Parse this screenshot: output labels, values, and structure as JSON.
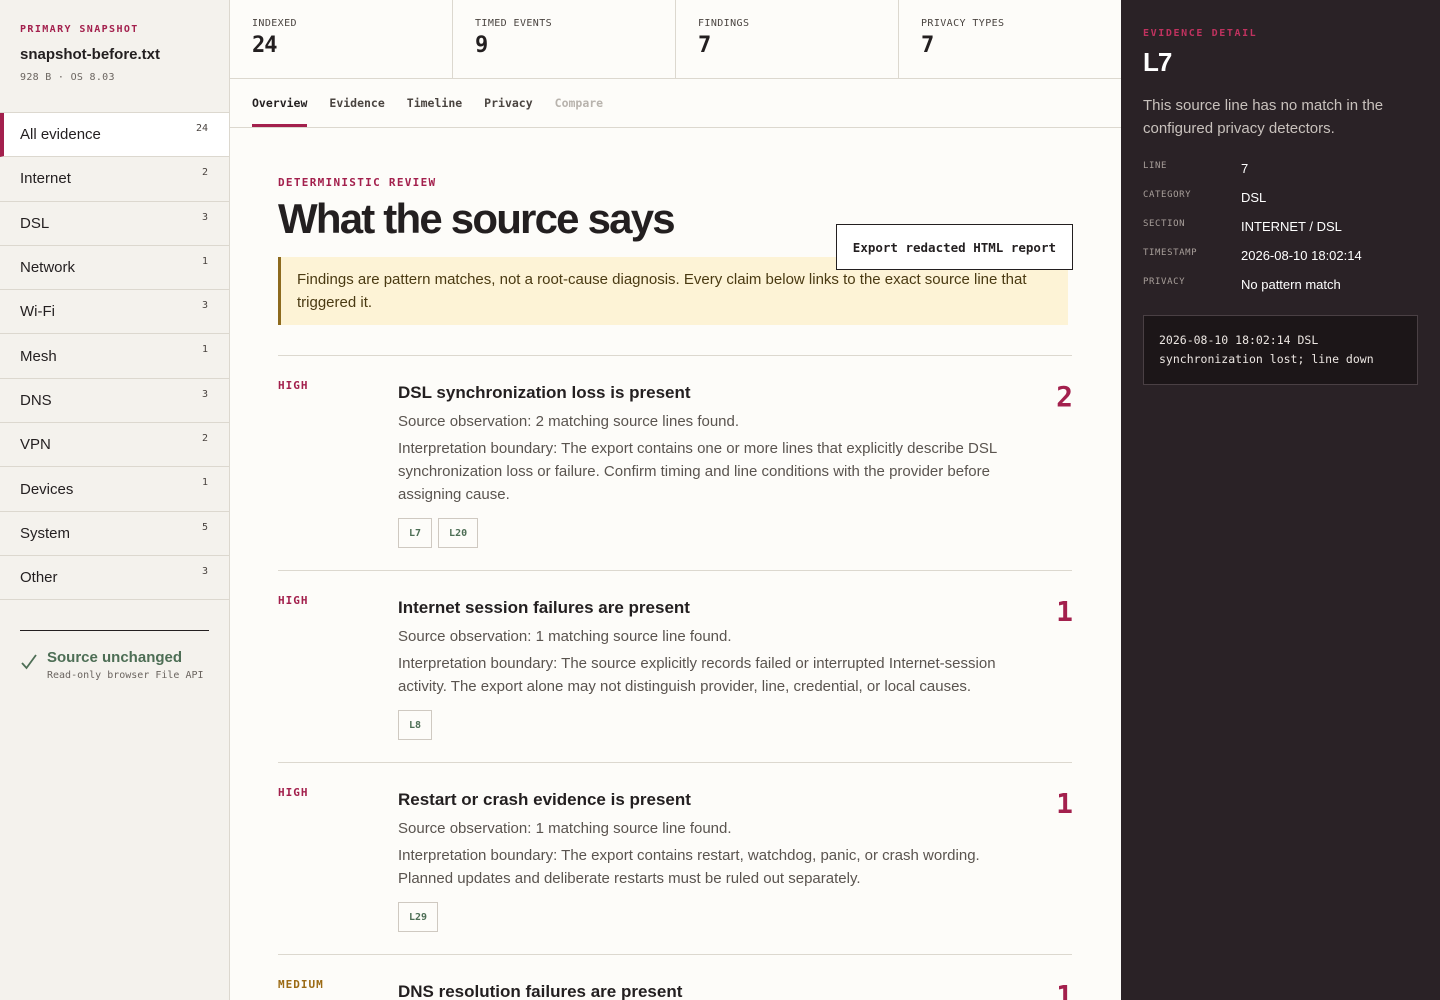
{
  "sidebar": {
    "kicker": "PRIMARY SNAPSHOT",
    "file_name": "snapshot-before.txt",
    "file_meta": "928 B · OS 8.03",
    "items": [
      {
        "label": "All evidence",
        "count": "24"
      },
      {
        "label": "Internet",
        "count": "2"
      },
      {
        "label": "DSL",
        "count": "3"
      },
      {
        "label": "Network",
        "count": "1"
      },
      {
        "label": "Wi-Fi",
        "count": "3"
      },
      {
        "label": "Mesh",
        "count": "1"
      },
      {
        "label": "DNS",
        "count": "3"
      },
      {
        "label": "VPN",
        "count": "2"
      },
      {
        "label": "Devices",
        "count": "1"
      },
      {
        "label": "System",
        "count": "5"
      },
      {
        "label": "Other",
        "count": "3"
      }
    ],
    "source_status": "Source unchanged",
    "source_sub": "Read-only browser File API"
  },
  "stats": [
    {
      "label": "INDEXED",
      "value": "24"
    },
    {
      "label": "TIMED EVENTS",
      "value": "9"
    },
    {
      "label": "FINDINGS",
      "value": "7"
    },
    {
      "label": "PRIVACY TYPES",
      "value": "7"
    }
  ],
  "tabs": [
    {
      "label": "Overview",
      "state": "active"
    },
    {
      "label": "Evidence",
      "state": "normal"
    },
    {
      "label": "Timeline",
      "state": "normal"
    },
    {
      "label": "Privacy",
      "state": "normal"
    },
    {
      "label": "Compare",
      "state": "disabled"
    }
  ],
  "main": {
    "kicker": "DETERMINISTIC REVIEW",
    "title": "What the source says",
    "export_label": "Export redacted HTML report",
    "notice": "Findings are pattern matches, not a root-cause diagnosis. Every claim below links to the exact source line that triggered it."
  },
  "findings": [
    {
      "severity": "HIGH",
      "title": "DSL synchronization loss is present",
      "observation": "Source observation: 2 matching source lines found.",
      "interpretation": "Interpretation boundary: The export contains one or more lines that explicitly describe DSL synchronization loss or failure. Confirm timing and line conditions with the provider before assigning cause.",
      "lines": [
        "L7",
        "L20"
      ],
      "count": "2"
    },
    {
      "severity": "HIGH",
      "title": "Internet session failures are present",
      "observation": "Source observation: 1 matching source line found.",
      "interpretation": "Interpretation boundary: The source explicitly records failed or interrupted Internet-session activity. The export alone may not distinguish provider, line, credential, or local causes.",
      "lines": [
        "L8"
      ],
      "count": "1"
    },
    {
      "severity": "HIGH",
      "title": "Restart or crash evidence is present",
      "observation": "Source observation: 1 matching source line found.",
      "interpretation": "Interpretation boundary: The export contains restart, watchdog, panic, or crash wording. Planned updates and deliberate restarts must be ruled out separately.",
      "lines": [
        "L29"
      ],
      "count": "1"
    },
    {
      "severity": "MEDIUM",
      "title": "DNS resolution failures are present",
      "observation": "",
      "interpretation": "",
      "lines": [],
      "count": "1"
    }
  ],
  "detail": {
    "kicker": "EVIDENCE DETAIL",
    "title": "L7",
    "description": "This source line has no match in the configured privacy detectors.",
    "rows": [
      {
        "key": "LINE",
        "value": "7"
      },
      {
        "key": "CATEGORY",
        "value": "DSL"
      },
      {
        "key": "SECTION",
        "value": "INTERNET / DSL"
      },
      {
        "key": "TIMESTAMP",
        "value": "2026-08-10 18:02:14"
      },
      {
        "key": "PRIVACY",
        "value": "No pattern match"
      }
    ],
    "source_line": "2026-08-10 18:02:14 DSL synchronization lost; line down"
  }
}
